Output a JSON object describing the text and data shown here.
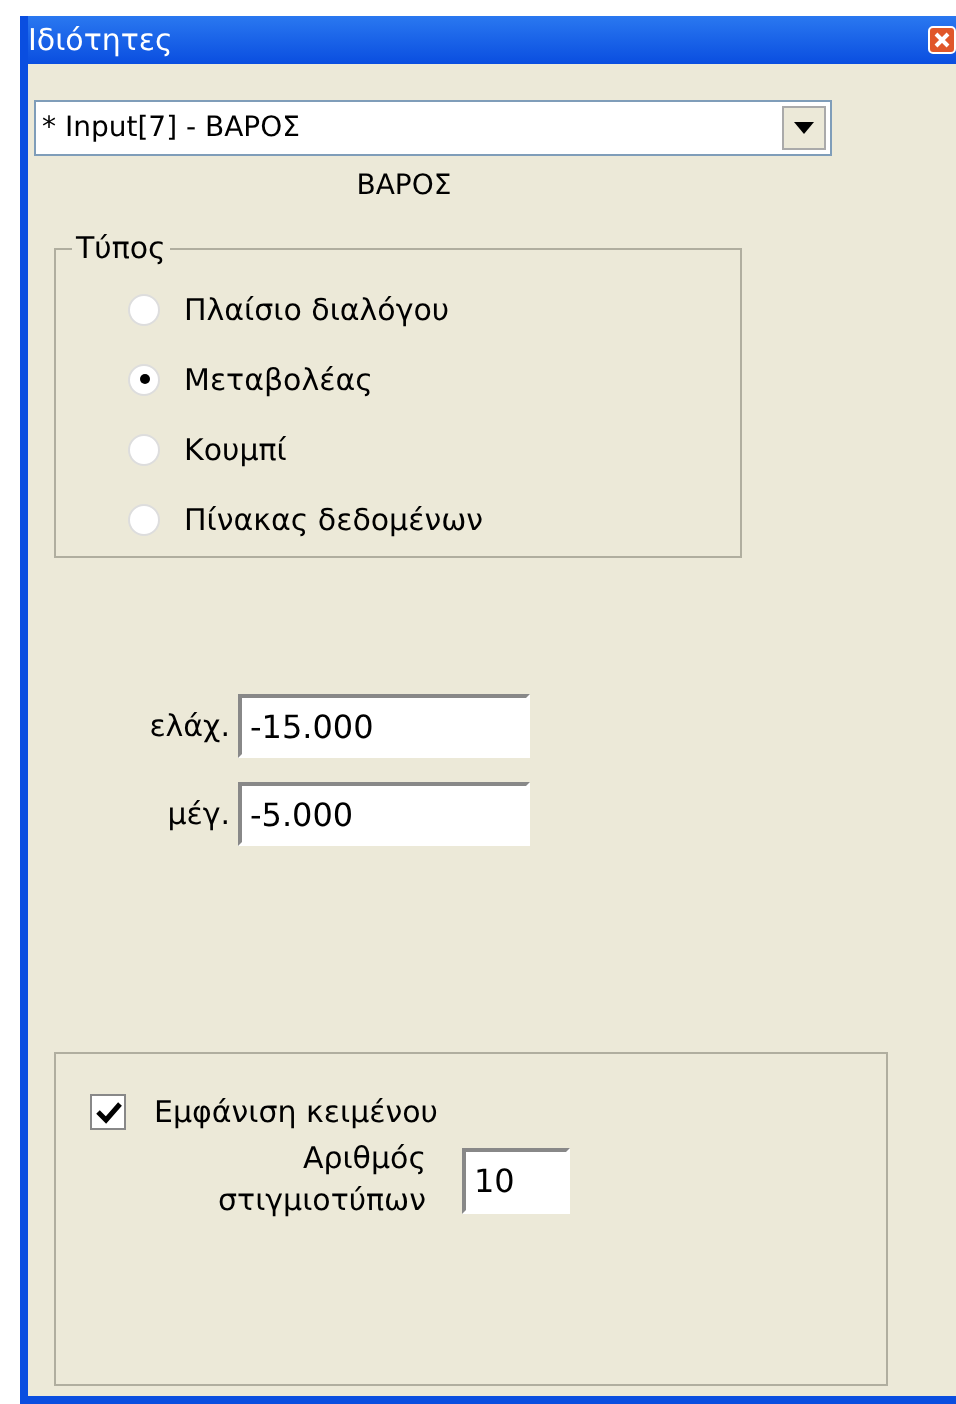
{
  "window": {
    "title": "Ιδιότητες"
  },
  "selector": {
    "value": "* Input[7] - ΒΑΡΟΣ"
  },
  "caption": "ΒΑΡΟΣ",
  "type_group": {
    "title": "Τύπος",
    "options": [
      {
        "label": "Πλαίσιο διαλόγου",
        "selected": false
      },
      {
        "label": "Μεταβολέας",
        "selected": true
      },
      {
        "label": "Κουμπί",
        "selected": false
      },
      {
        "label": "Πίνακας δεδομένων",
        "selected": false
      }
    ]
  },
  "range_fields": [
    {
      "label": "ελάχ.",
      "value": "-15.000"
    },
    {
      "label": "μέγ.",
      "value": "-5.000"
    }
  ],
  "display_group": {
    "show_text": {
      "label": "Εμφάνιση κειμένου",
      "checked": true
    },
    "snapshots": {
      "label_lines": [
        "Αριθμός",
        "στιγμιοτύπων"
      ],
      "value": "10"
    }
  }
}
